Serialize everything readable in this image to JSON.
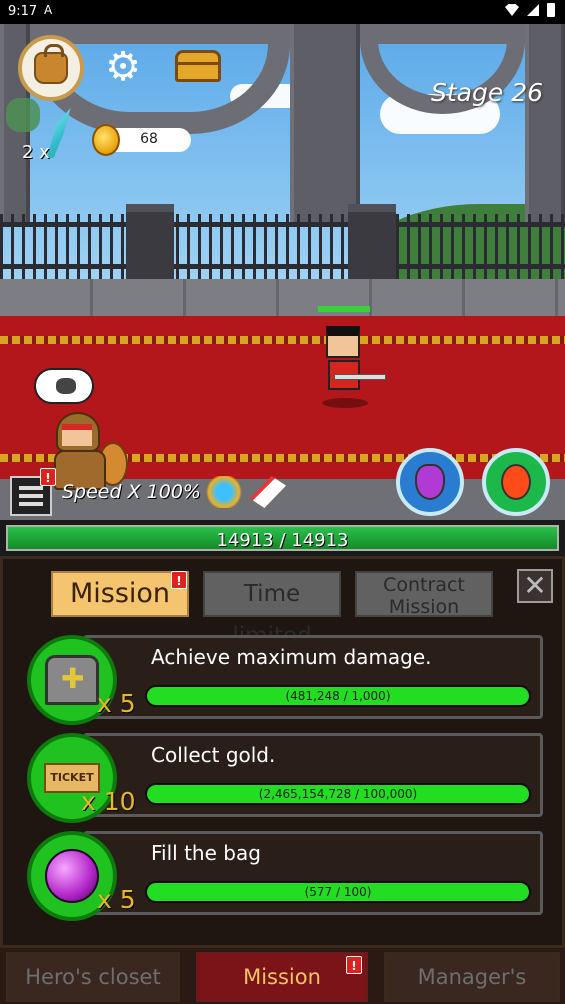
{
  "status_bar": {
    "time": "9:17",
    "a_icon": "A"
  },
  "hud": {
    "gold": "68",
    "multiplier": "2 x",
    "stage": "Stage 26",
    "speed": "Speed X 100%",
    "badge": "!"
  },
  "player_hp": {
    "text": "14913 / 14913",
    "fraction": 1.0
  },
  "tabs": {
    "mission": "Mission",
    "time_limited": "Time limited",
    "contract_line1": "Contract",
    "contract_line2": "Mission",
    "close": "✕"
  },
  "missions": [
    {
      "title": "Achieve maximum damage.",
      "multiplier": "x 5",
      "progress": "(481,248 / 1,000)",
      "icon": "tomb-icon"
    },
    {
      "title": "Collect gold.",
      "multiplier": "x 10",
      "progress": "(2,465,154,728 / 100,000)",
      "icon": "ticket-icon",
      "icon_label": "TICKET"
    },
    {
      "title": "Fill the bag",
      "multiplier": "x 5",
      "progress": "(577 / 100)",
      "icon": "gem-icon"
    }
  ],
  "bottom_nav": {
    "heros_closet": "Hero's closet",
    "mission": "Mission",
    "managers_closet": "Manager's closet"
  },
  "colors": {
    "accent": "#f5c46e",
    "progress_green": "#22dd22",
    "carpet": "#b3161b",
    "badge_red": "#e0221e"
  }
}
